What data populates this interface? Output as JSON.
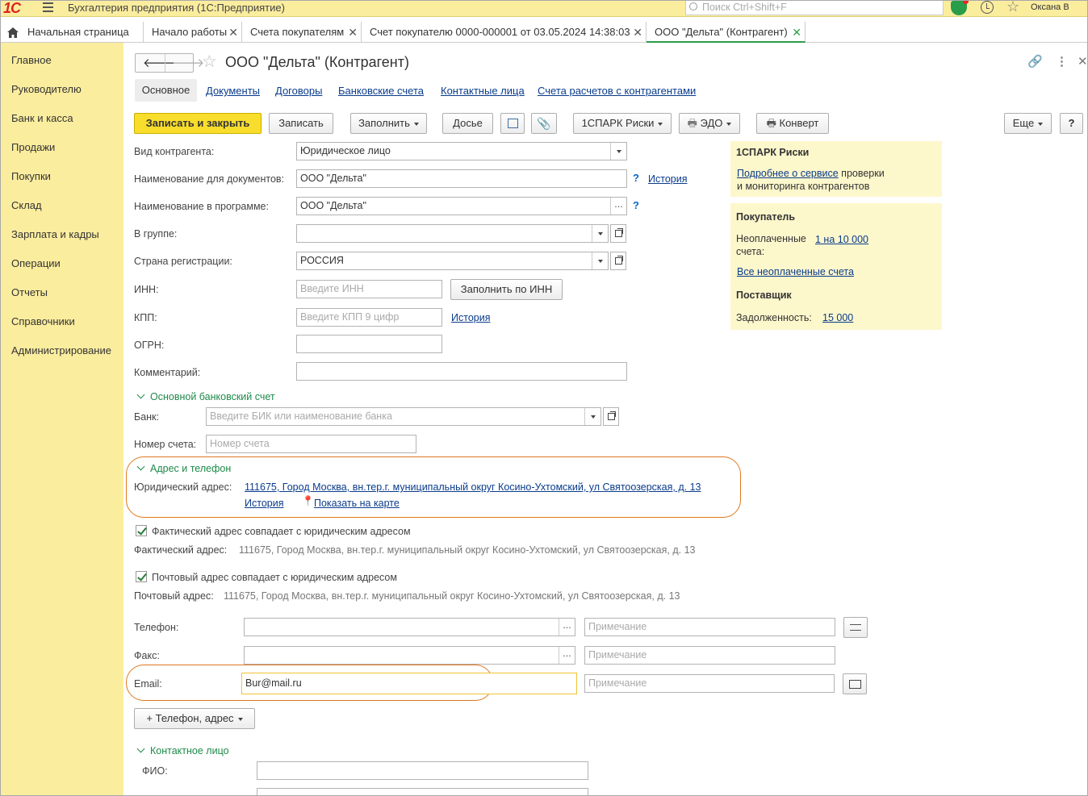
{
  "topbar": {
    "logo": "1С",
    "app_title": "Бухгалтерия предприятия  (1С:Предприятие)",
    "search_placeholder": "Поиск Ctrl+Shift+F",
    "user": "Оксана В"
  },
  "tabs": [
    {
      "label": "Начальная страница"
    },
    {
      "label": "Начало работы"
    },
    {
      "label": "Счета покупателям"
    },
    {
      "label": "Счет покупателю 0000-000001 от 03.05.2024 14:38:03"
    },
    {
      "label": "ООО \"Дельта\" (Контрагент)"
    }
  ],
  "sidebar": {
    "items": [
      "Главное",
      "Руководителю",
      "Банк и касса",
      "Продажи",
      "Покупки",
      "Склад",
      "Зарплата и кадры",
      "Операции",
      "Отчеты",
      "Справочники",
      "Администрирование"
    ]
  },
  "form": {
    "title": "ООО \"Дельта\" (Контрагент)",
    "subtabs": [
      "Основное",
      "Документы",
      "Договоры",
      "Банковские счета",
      "Контактные лица",
      "Счета расчетов с контрагентами"
    ],
    "toolbar": {
      "save_close": "Записать и закрыть",
      "save": "Записать",
      "fill": "Заполнить",
      "dossier": "Досье",
      "spark": "1СПАРК Риски",
      "edo": "ЭДО",
      "envelope": "Конверт",
      "more": "Еще",
      "help": "?"
    },
    "fields": {
      "kind_label": "Вид контрагента:",
      "kind_value": "Юридическое лицо",
      "docname_label": "Наименование для документов:",
      "docname_value": "ООО \"Дельта\"",
      "docname_history": "История",
      "progname_label": "Наименование в программе:",
      "progname_value": "ООО \"Дельта\"",
      "group_label": "В группе:",
      "group_value": "",
      "country_label": "Страна регистрации:",
      "country_value": "РОССИЯ",
      "inn_label": "ИНН:",
      "inn_placeholder": "Введите ИНН",
      "inn_fill": "Заполнить по ИНН",
      "kpp_label": "КПП:",
      "kpp_placeholder": "Введите КПП 9 цифр",
      "kpp_history": "История",
      "ogrn_label": "ОГРН:",
      "ogrn_value": "",
      "comment_label": "Комментарий:",
      "comment_value": "",
      "help_mark": "?"
    },
    "bank": {
      "section": "Основной банковский счет",
      "bank_label": "Банк:",
      "bank_placeholder": "Введите БИК или наименование банка",
      "account_label": "Номер счета:",
      "account_placeholder": "Номер счета"
    },
    "address": {
      "section": "Адрес и телефон",
      "legal_label": "Юридический адрес:",
      "legal_value": "111675, Город Москва, вн.тер.г. муниципальный округ Косино-Ухтомский, ул Святоозерская, д. 13",
      "history": "История",
      "map": "Показать на карте",
      "actual_check": "Фактический адрес совпадает с юридическим адресом",
      "actual_label": "Фактический адрес:",
      "actual_value": "111675, Город Москва, вн.тер.г. муниципальный округ Косино-Ухтомский, ул Святоозерская, д. 13",
      "postal_check": "Почтовый адрес совпадает с юридическим адресом",
      "postal_label": "Почтовый адрес:",
      "postal_value": "111675, Город Москва, вн.тер.г. муниципальный округ Косино-Ухтомский, ул Святоозерская, д. 13"
    },
    "contacts": {
      "phone_label": "Телефон:",
      "phone_value": "",
      "fax_label": "Факс:",
      "fax_value": "",
      "email_label": "Email:",
      "email_value": "Bur@mail.ru",
      "note_placeholder": "Примечание",
      "add_button": "+ Телефон, адрес"
    },
    "contact_person": {
      "section": "Контактное лицо",
      "fio_label": "ФИО:",
      "fio_value": ""
    }
  },
  "right": {
    "spark_title": "1СПАРК Риски",
    "spark_link": "Подробнее о сервисе",
    "spark_text1": " проверки",
    "spark_text2": "и мониторинга контрагентов",
    "buyer_title": "Покупатель",
    "unpaid_label1": "Неоплаченные",
    "unpaid_label2": "счета:",
    "unpaid_value": "1 на 10 000",
    "all_unpaid": "Все неоплаченные счета",
    "supplier_title": "Поставщик",
    "debt_label": "Задолженность:",
    "debt_value": "15 000"
  },
  "colors": {
    "accent_yellow": "#fbed9e",
    "highlight_orange": "#e07820",
    "link": "#0a3c8c",
    "section_green": "#1e8a4a"
  }
}
